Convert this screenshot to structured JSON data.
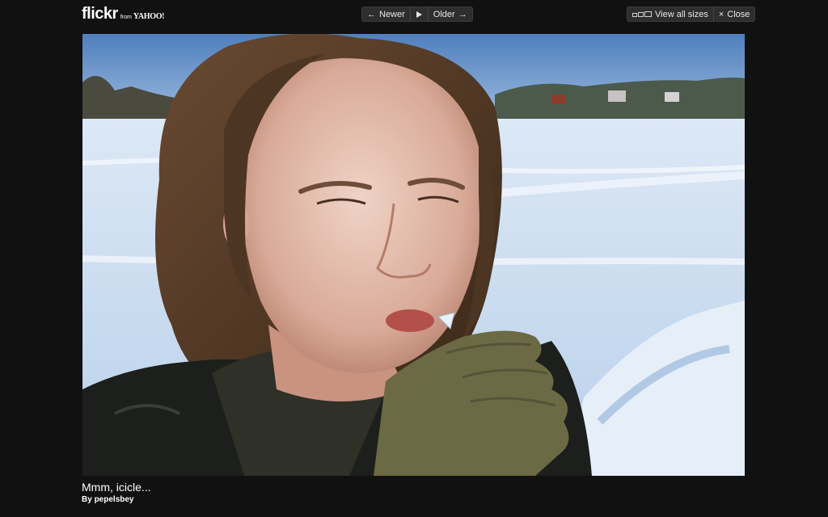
{
  "header": {
    "logo": {
      "main": "flickr",
      "from": "from",
      "yahoo": "YAHOO!"
    },
    "nav": {
      "newer_arrow": "←",
      "newer_label": "Newer",
      "older_label": "Older",
      "older_arrow": "→",
      "play_icon": "play-icon"
    },
    "actions": {
      "view_all_sizes_label": "View all sizes",
      "sizes_icon": "sizes-icon",
      "close_symbol": "×",
      "close_label": "Close"
    }
  },
  "photo": {
    "title": "Mmm, icicle...",
    "author_prefix": "By",
    "author": "pepelsbey"
  },
  "colors": {
    "background": "#111111",
    "button_bg": "#2e2e2e",
    "text": "#ffffff"
  }
}
